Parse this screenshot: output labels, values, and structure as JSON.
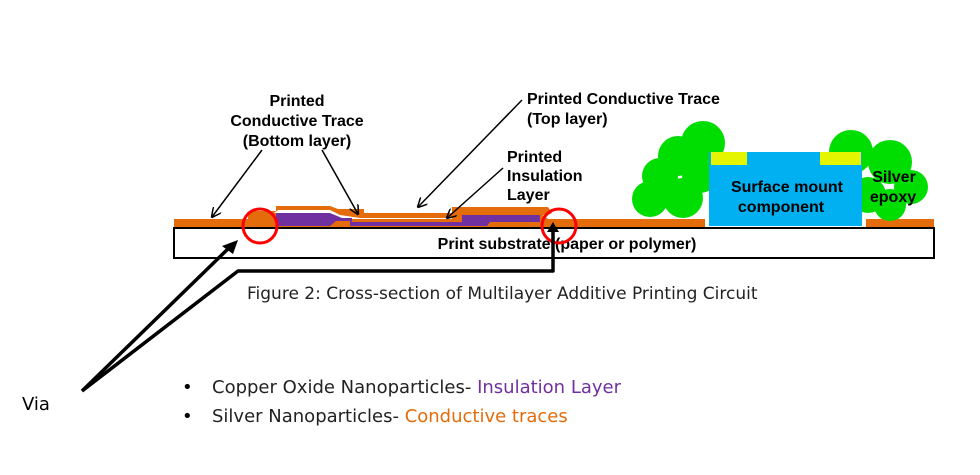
{
  "diagram": {
    "labels": {
      "bottom_trace": [
        "Printed",
        "Conductive Trace",
        "(Bottom layer)"
      ],
      "top_trace": [
        "Printed Conductive Trace",
        "(Top layer)"
      ],
      "insulation": [
        "Printed",
        "Insulation",
        "Layer"
      ],
      "component": [
        "Surface mount",
        "component"
      ],
      "epoxy": [
        "Silver",
        "epoxy"
      ],
      "substrate": "Print substrate (paper or polymer)"
    },
    "caption": "Figure 2: Cross-section of Multilayer Additive Printing Circuit",
    "via_label": "Via",
    "bullets": [
      {
        "prefix": "Copper Oxide Nanoparticles- ",
        "highlight": "Insulation Layer",
        "color": "#7030a0"
      },
      {
        "prefix": "Silver Nanoparticles- ",
        "highlight": "Conductive traces",
        "color": "#e46c0a"
      }
    ],
    "bullet_glyph": "•",
    "colors": {
      "conductive": "#e46c0a",
      "insulation": "#7030a0",
      "component": "#00b0f0",
      "epoxy": "#00dd00",
      "pad": "#e5f500",
      "via_circle": "#ff0000"
    }
  }
}
